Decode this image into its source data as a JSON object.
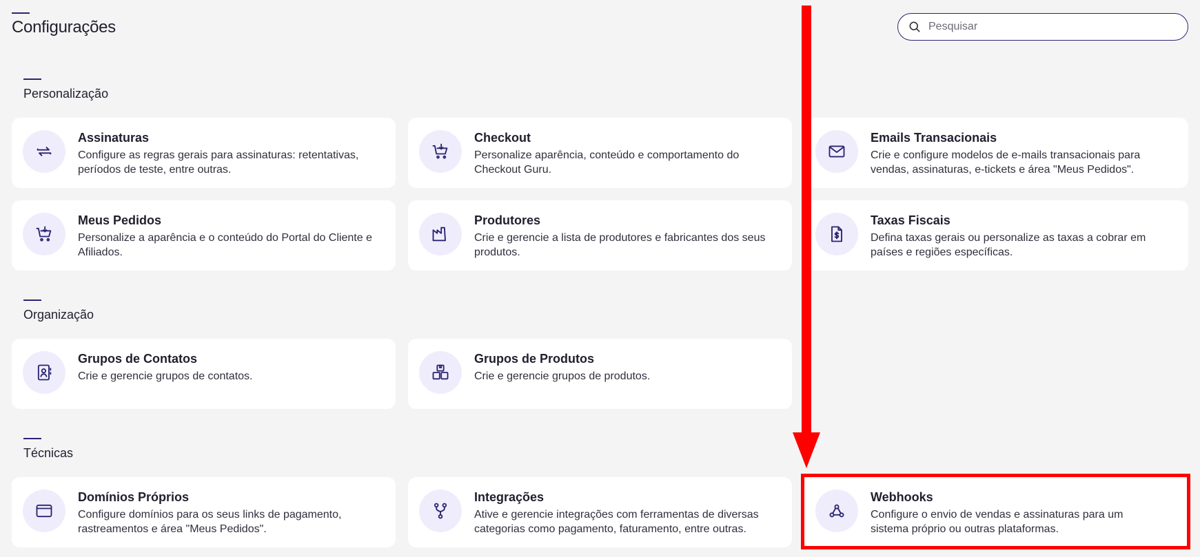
{
  "header": {
    "title": "Configurações"
  },
  "search": {
    "placeholder": "Pesquisar"
  },
  "sections": [
    {
      "label": "Personalização"
    },
    {
      "label": "Organização"
    },
    {
      "label": "Técnicas"
    }
  ],
  "cards": {
    "assinaturas": {
      "title": "Assinaturas",
      "desc": "Configure as regras gerais para assinaturas: retentativas, períodos de teste, entre outras.",
      "icon": "refresh-arrows-icon"
    },
    "checkout": {
      "title": "Checkout",
      "desc": "Personalize aparência, conteúdo e comportamento do Checkout Guru.",
      "icon": "cart-download-icon"
    },
    "emails": {
      "title": "Emails Transacionais",
      "desc": "Crie e configure modelos de e-mails transacionais para vendas, assinaturas, e-tickets e área \"Meus Pedidos\".",
      "icon": "mail-icon"
    },
    "pedidos": {
      "title": "Meus Pedidos",
      "desc": "Personalize a aparência e o conteúdo do Portal do Cliente e Afiliados.",
      "icon": "cart-download-icon"
    },
    "produtores": {
      "title": "Produtores",
      "desc": "Crie e gerencie a lista de produtores e fabricantes dos seus produtos.",
      "icon": "factory-icon"
    },
    "taxas": {
      "title": "Taxas Fiscais",
      "desc": "Defina taxas gerais ou personalize as taxas a cobrar em países e regiões específicas.",
      "icon": "tax-document-icon"
    },
    "contatos": {
      "title": "Grupos de Contatos",
      "desc": "Crie e gerencie grupos de contatos.",
      "icon": "contact-book-icon"
    },
    "produtos": {
      "title": "Grupos de Produtos",
      "desc": "Crie e gerencie grupos de produtos.",
      "icon": "boxes-icon"
    },
    "dominios": {
      "title": "Domínios Próprios",
      "desc": "Configure domínios para os seus links de pagamento, rastreamentos e área \"Meus Pedidos\".",
      "icon": "browser-window-icon"
    },
    "integracoes": {
      "title": "Integrações",
      "desc": "Ative e gerencie integrações com ferramentas de diversas categorias como pagamento, faturamento, entre outras.",
      "icon": "git-branch-icon"
    },
    "webhooks": {
      "title": "Webhooks",
      "desc": "Configure o envio de vendas e assinaturas para um sistema próprio ou outras plataformas.",
      "icon": "webhook-icon"
    }
  },
  "colors": {
    "accent": "#2a2470",
    "icon_bg": "#efedfb",
    "annotation": "#ff0000"
  }
}
